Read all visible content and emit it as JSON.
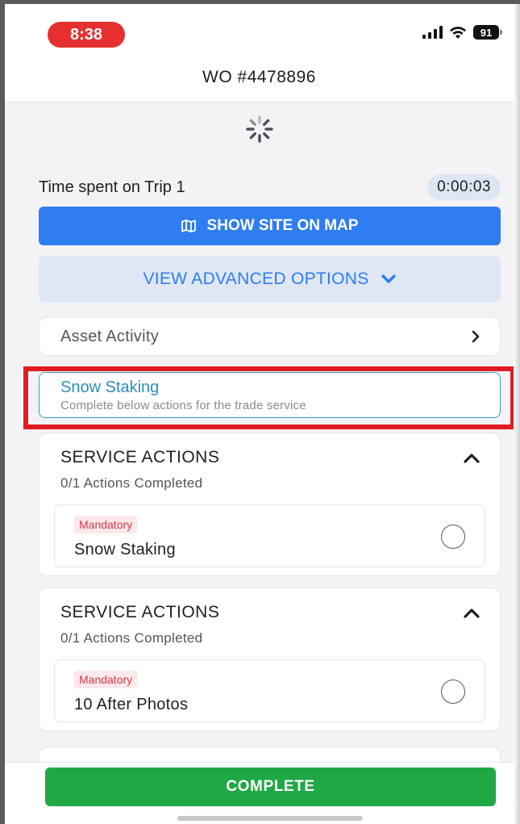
{
  "status_bar": {
    "time": "8:38",
    "battery": "91",
    "icons": [
      "signal-icon",
      "wifi-icon",
      "battery-icon"
    ]
  },
  "header": {
    "title": "WO #4478896"
  },
  "loading": {
    "icon": "spinner-icon"
  },
  "trip": {
    "label": "Time spent on Trip 1",
    "timer": "0:00:03"
  },
  "map_button": {
    "label": "SHOW SITE ON MAP",
    "icon": "map-icon"
  },
  "advanced_options": {
    "label": "VIEW ADVANCED OPTIONS",
    "icon": "chevron-down-icon"
  },
  "asset_activity": {
    "label": "Asset Activity",
    "icon": "chevron-right-icon"
  },
  "service_tab": {
    "title": "Snow Staking",
    "subtitle": "Complete below actions for the trade service"
  },
  "service_sections": [
    {
      "title": "SERVICE ACTIONS",
      "count": "0/1 Actions Completed",
      "actions": [
        {
          "badge": "Mandatory",
          "label": "Snow Staking",
          "completed": false
        }
      ]
    },
    {
      "title": "SERVICE ACTIONS",
      "count": "0/1 Actions Completed",
      "actions": [
        {
          "badge": "Mandatory",
          "label": "10 After Photos",
          "completed": false
        }
      ]
    }
  ],
  "footer": {
    "complete_label": "COMPLETE"
  },
  "colors": {
    "primary_blue": "#2f7df1",
    "complete_green": "#1fa845",
    "highlight_red": "#e01b24",
    "mandatory_red": "#d23a4b",
    "service_teal": "#2a8fb8"
  }
}
